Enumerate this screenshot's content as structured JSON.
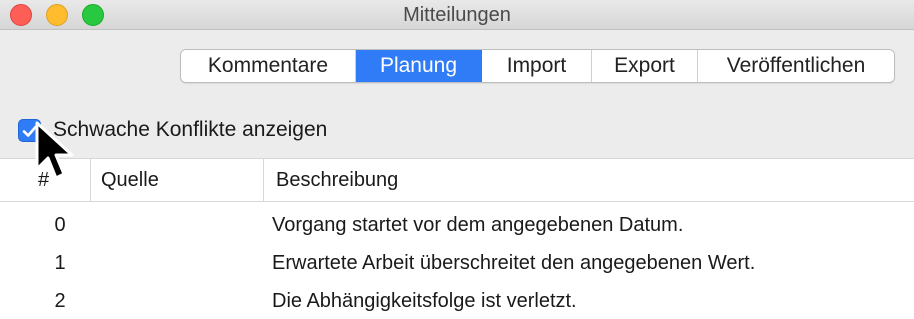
{
  "window": {
    "title": "Mitteilungen"
  },
  "tabs": [
    {
      "label": "Kommentare",
      "active": false
    },
    {
      "label": "Planung",
      "active": true
    },
    {
      "label": "Import",
      "active": false
    },
    {
      "label": "Export",
      "active": false
    },
    {
      "label": "Veröffentlichen",
      "active": false
    }
  ],
  "option": {
    "label": "Schwache Konflikte anzeigen",
    "checked": true
  },
  "table": {
    "columns": [
      "#",
      "Quelle",
      "Beschreibung"
    ],
    "rows": [
      {
        "num": "0",
        "source": "",
        "description": "Vorgang startet vor dem angegebenen Datum."
      },
      {
        "num": "1",
        "source": "",
        "description": "Erwartete Arbeit überschreitet den angegebenen Wert."
      },
      {
        "num": "2",
        "source": "",
        "description": "Die Abhängigkeitsfolge ist verletzt."
      }
    ]
  },
  "colors": {
    "accent": "#2f7cf6",
    "close": "#fd5f57",
    "minimize": "#febc2e",
    "maximize": "#28c840"
  }
}
